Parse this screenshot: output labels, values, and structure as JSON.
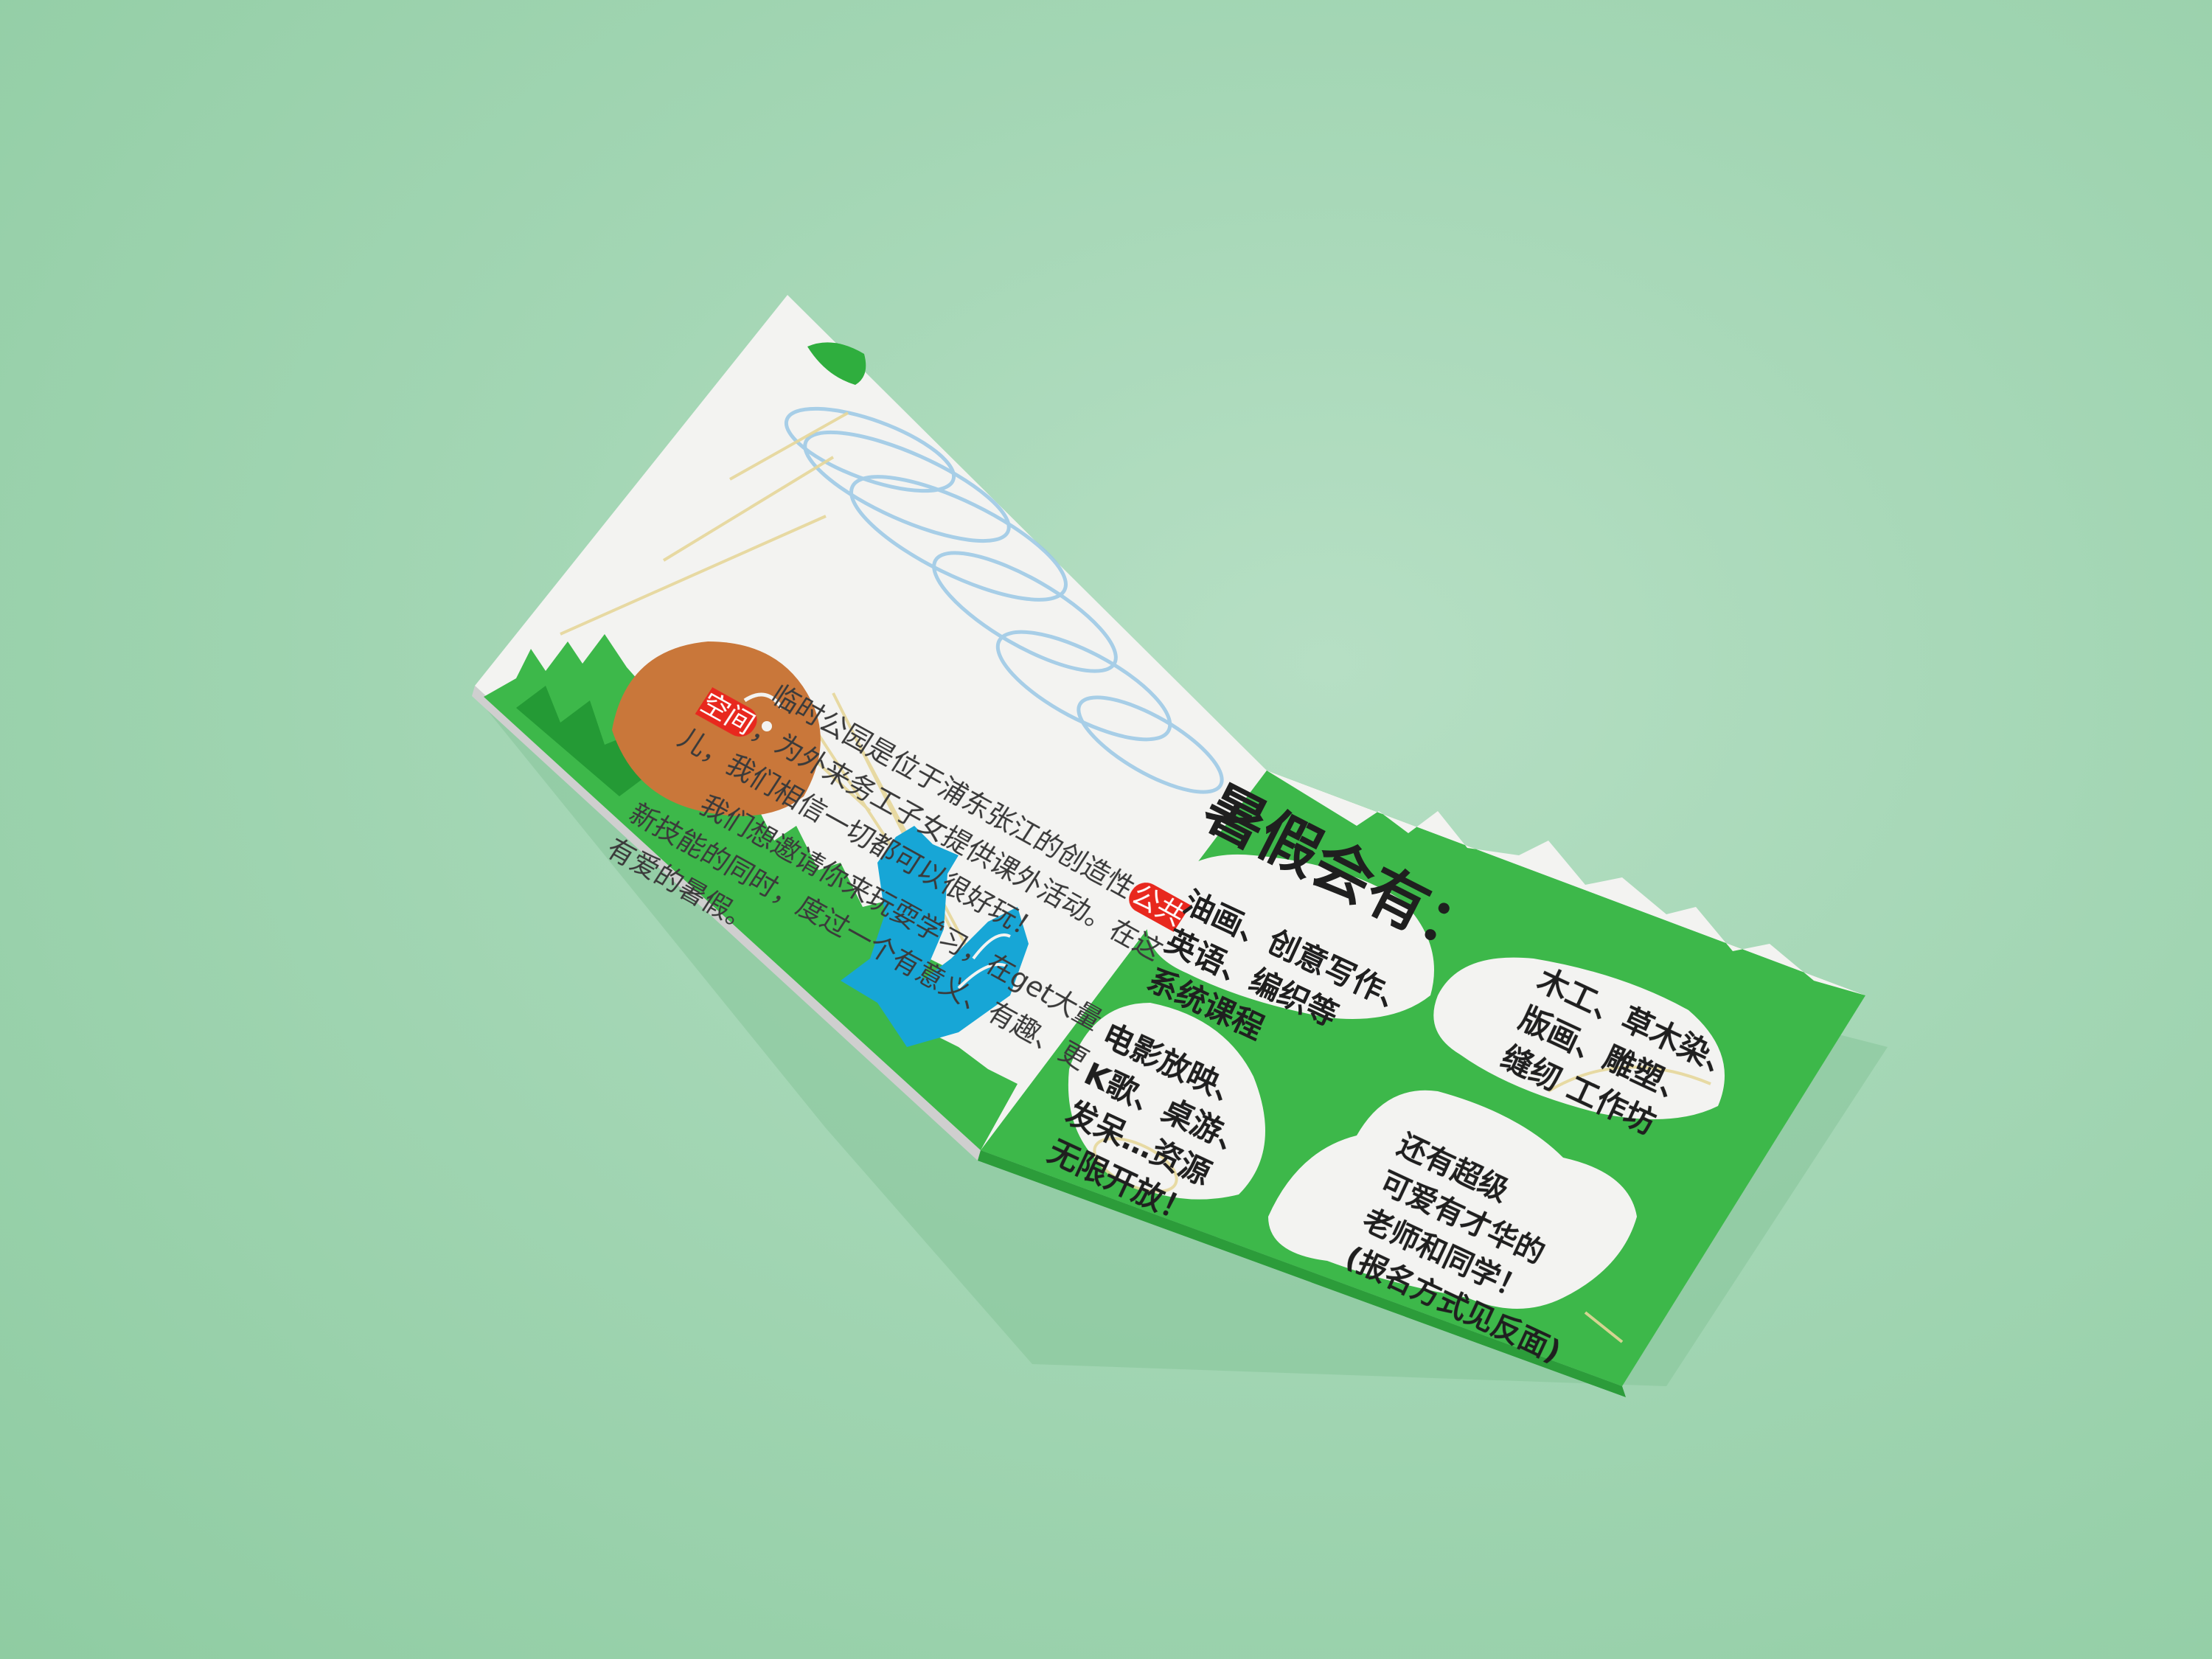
{
  "left_page": {
    "paragraph1_before": "临时公园是位于浦东张江的创造性",
    "paragraph1_highlight": "公共空间",
    "paragraph1_after": "，为外来务工子女提供课外活动。在这儿，我们相信一切都可以很好玩！",
    "paragraph2": "我们想邀请你来玩耍学习，在get大量新技能的同时，度过一个有意义、有趣、更有爱的暑假。"
  },
  "right_page": {
    "title": "暑假会有：",
    "bubble1": "油画、创意写作、\n英语、编织等\n系统课程",
    "bubble2": "木工、草木染、\n版画、雕塑、\n缝纫 工作坊",
    "bubble3": "电影放映、\n K歌、桌游、\n 发呆…资源\n无限开放！",
    "bubble4": "还有超级\n可爱有才华的\n老师和同学！\n(报名方式见反面)"
  },
  "colors": {
    "background": "#a3d6b4",
    "paper": "#f2f2f0",
    "green": "#3db84a",
    "dark_green": "#249a35",
    "hedgehog": "#c9773a",
    "fox": "#17a6d6",
    "highlight_red": "#e8281e",
    "crayon_blue": "#9ac8e6",
    "crayon_yellow": "#e6d79a"
  }
}
